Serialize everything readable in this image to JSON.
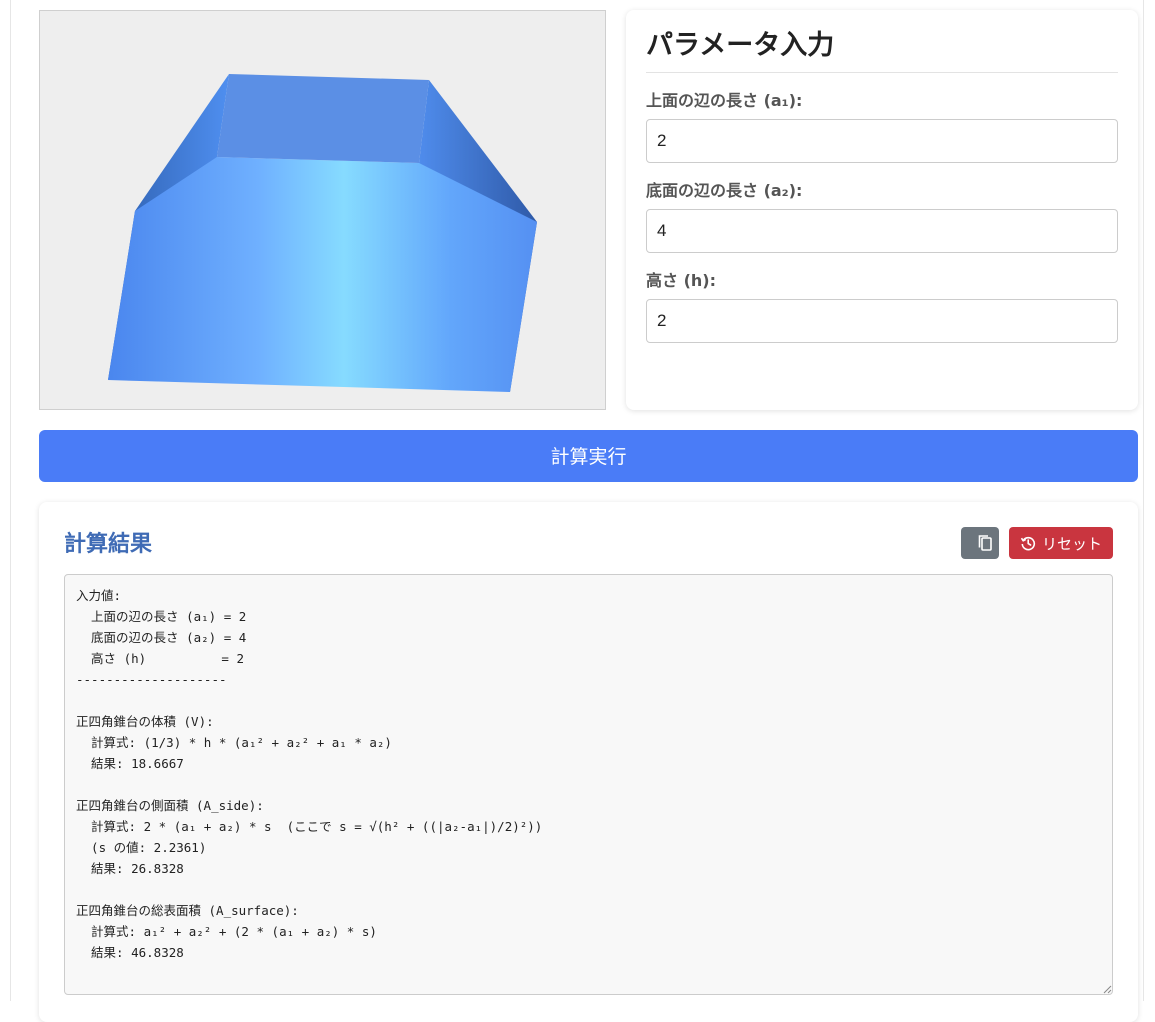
{
  "params": {
    "title": "パラメータ入力",
    "fields": [
      {
        "label": "上面の辺の長さ (a₁):",
        "value": "2"
      },
      {
        "label": "底面の辺の長さ (a₂):",
        "value": "4"
      },
      {
        "label": "高さ (h):",
        "value": "2"
      }
    ]
  },
  "actions": {
    "calculate_label": "計算実行"
  },
  "result": {
    "title": "計算結果",
    "reset_label": "リセット",
    "output": "入力値:\n  上面の辺の長さ (a₁) = 2\n  底面の辺の長さ (a₂) = 4\n  高さ (h)          = 2\n--------------------\n\n正四角錐台の体積 (V):\n  計算式: (1/3) * h * (a₁² + a₂² + a₁ * a₂)\n  結果: 18.6667\n\n正四角錐台の側面積 (A_side):\n  計算式: 2 * (a₁ + a₂) * s  (ここで s = √(h² + ((|a₂-a₁|)/2)²))\n  (s の値: 2.2361)\n  結果: 26.8328\n\n正四角錐台の総表面積 (A_surface):\n  計算式: a₁² + a₂² + (2 * (a₁ + a₂) * s)\n  結果: 46.8328"
  },
  "icons": {
    "copy": "copy-icon",
    "reset": "history-icon"
  },
  "colors": {
    "primary": "#4a7cf7",
    "danger": "#c9353f",
    "secondary": "#6c757d",
    "result_title": "#3f6bb5",
    "frustum_light": "#86dbff",
    "frustum_mid": "#5b9bf5",
    "frustum_dark": "#2f5aa8"
  }
}
